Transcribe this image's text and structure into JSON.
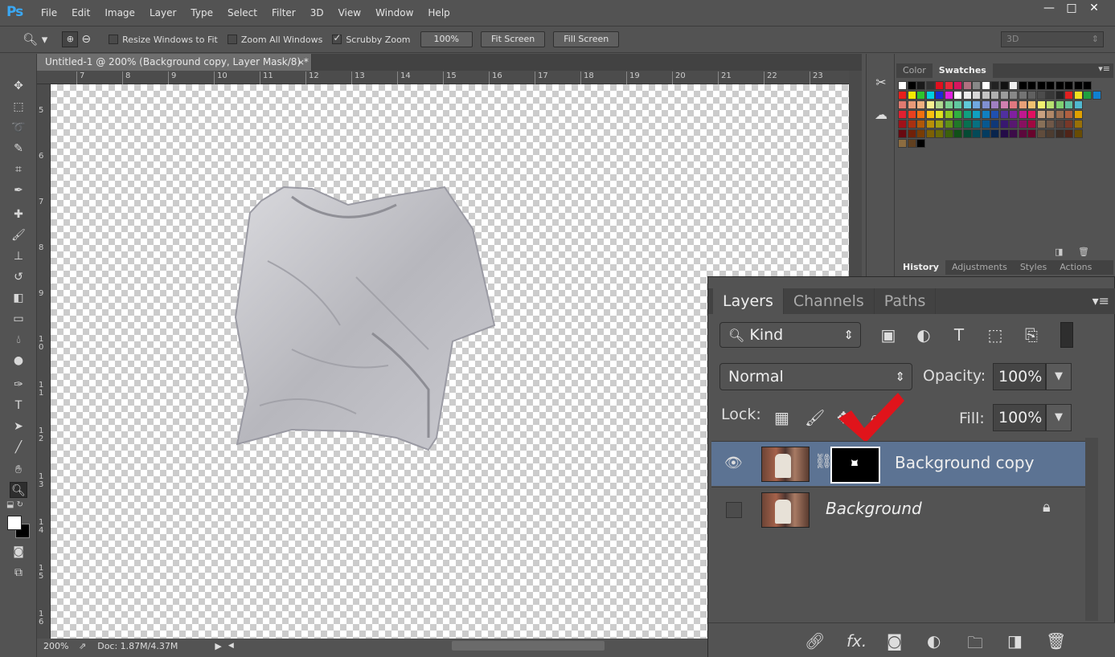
{
  "app": {
    "logo": "Ps"
  },
  "menu": [
    "File",
    "Edit",
    "Image",
    "Layer",
    "Type",
    "Select",
    "Filter",
    "3D",
    "View",
    "Window",
    "Help"
  ],
  "window_controls": [
    "—",
    "□",
    "✕"
  ],
  "options": {
    "resize_windows": "Resize Windows to Fit",
    "zoom_all": "Zoom All Windows",
    "scrubby": "Scrubby Zoom",
    "zoom_value": "100%",
    "fit_screen": "Fit Screen",
    "fill_screen": "Fill Screen",
    "workspace": "3D"
  },
  "document": {
    "tab_title": "Untitled-1 @ 200% (Background copy, Layer Mask/8) *",
    "close": "×",
    "ruler_h": [
      "7",
      "8",
      "9",
      "10",
      "11",
      "12",
      "13",
      "14",
      "15",
      "16",
      "17",
      "18",
      "19",
      "20",
      "21",
      "22",
      "23"
    ],
    "ruler_v": [
      "5",
      "6",
      "7",
      "8",
      "9",
      "10",
      "11",
      "12",
      "13",
      "14",
      "15",
      "16"
    ]
  },
  "status": {
    "zoom": "200%",
    "doc": "Doc: 1.87M/4.37M"
  },
  "swatch_panel": {
    "tabs": [
      "Color",
      "Swatches"
    ],
    "active": "Swatches"
  },
  "history_panel": {
    "tabs": [
      "History",
      "Adjustments",
      "Styles",
      "Actions"
    ],
    "active": "History"
  },
  "layers_panel": {
    "tabs": [
      "Layers",
      "Channels",
      "Paths"
    ],
    "active": "Layers",
    "kind": "Kind",
    "blend_mode": "Normal",
    "opacity_label": "Opacity:",
    "opacity": "100%",
    "lock_label": "Lock:",
    "fill_label": "Fill:",
    "fill": "100%",
    "layers": [
      {
        "name": "Background copy",
        "visible": true,
        "selected": true,
        "has_mask": true
      },
      {
        "name": "Background",
        "visible": false,
        "selected": false,
        "locked": true
      }
    ]
  },
  "colors": {
    "selection": "#5c7393",
    "checkmark": "#e0141b",
    "ps_blue": "#3aa8f4"
  }
}
